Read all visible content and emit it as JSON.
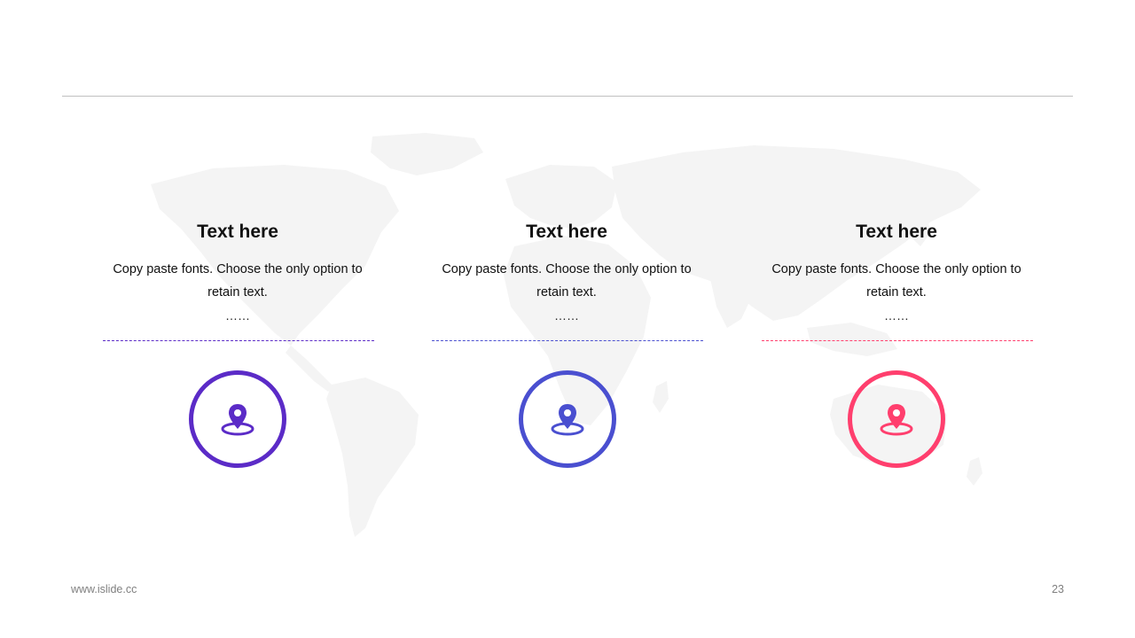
{
  "colors": {
    "purple": "#5b2bc7",
    "blue": "#4a4fd0",
    "pink": "#ff3f6e",
    "map": "#f4f4f4",
    "rule": "#bfbfbf"
  },
  "background": {
    "map_icon": "world-map"
  },
  "cards": [
    {
      "title": "Text here",
      "body": "Copy paste fonts. Choose the only option to retain text.",
      "ellipsis": "……",
      "icon": "location-pin-icon",
      "color": "#5b2bc7"
    },
    {
      "title": "Text here",
      "body": "Copy paste fonts. Choose the only option to retain text.",
      "ellipsis": "……",
      "icon": "location-pin-icon",
      "color": "#4a4fd0"
    },
    {
      "title": "Text here",
      "body": "Copy paste fonts. Choose the only option to retain text.",
      "ellipsis": "……",
      "icon": "location-pin-icon",
      "color": "#ff3f6e"
    }
  ],
  "footer": {
    "url": "www.islide.cc",
    "page_number": "23"
  }
}
